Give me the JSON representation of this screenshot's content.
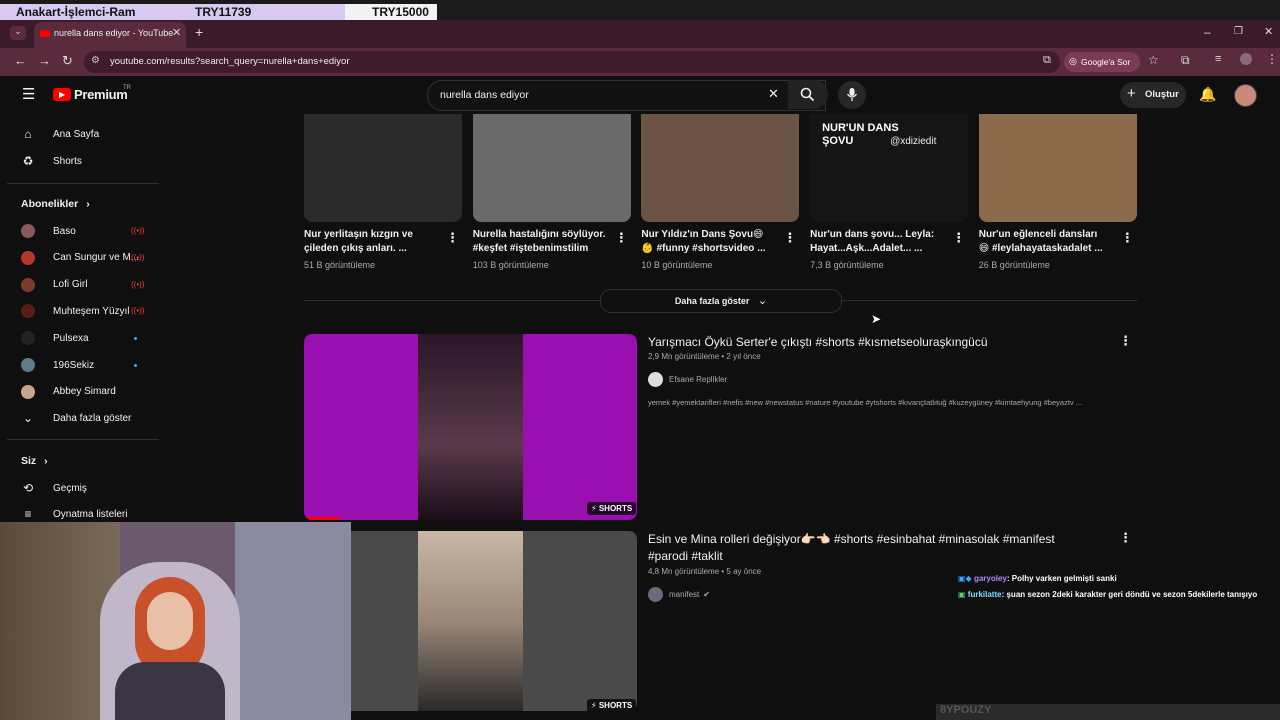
{
  "overlay": {
    "left_label": "Anakart-İşlemci-Ram",
    "mid_price": "TRY11739",
    "right_price": "TRY15000"
  },
  "browser": {
    "tab_title": "nurella dans ediyor - YouTube",
    "url": "youtube.com/results?search_query=nurella+dans+ediyor",
    "google_sor": "Google'a Sor"
  },
  "header": {
    "logo": "Premium",
    "logo_suffix": "TR",
    "search_value": "nurella dans ediyor",
    "create_label": "Oluştur"
  },
  "sidebar": {
    "home": "Ana Sayfa",
    "shorts": "Shorts",
    "subscriptions_title": "Abonelikler",
    "subscriptions": [
      {
        "name": "Baso",
        "status": "live",
        "color": "#8a5a5a"
      },
      {
        "name": "Can Sungur ve M...",
        "status": "live",
        "color": "#b4372e"
      },
      {
        "name": "Lofi Girl",
        "status": "live",
        "color": "#7a3b2a"
      },
      {
        "name": "Muhteşem Yüzyıl",
        "status": "live",
        "color": "#5a1d14"
      },
      {
        "name": "Pulsexa",
        "status": "new",
        "color": "#222222"
      },
      {
        "name": "196Sekiz",
        "status": "new",
        "color": "#5b7c8a"
      },
      {
        "name": "Abbey Simard",
        "status": "",
        "color": "#c9a58a"
      }
    ],
    "show_more": "Daha fazla göster",
    "you_title": "Siz",
    "history": "Geçmiş",
    "playlists": "Oynatma listeleri"
  },
  "shorts": [
    {
      "title_line1": "Nur yerlitaşın kızgın ve",
      "title_line2": "çileden çıkış anları. ...",
      "views": "51 B görüntüleme",
      "color": "#2a2a2a"
    },
    {
      "title_line1": "Nurella hastalığını söylüyor.",
      "title_line2": "#keşfet #iştebenimstilim",
      "views": "103 B görüntüleme",
      "color": "#6a6a6a"
    },
    {
      "title_line1": "Nur Yıldız'ın Dans Şovu😄",
      "title_line2": "👶 #funny #shortsvideo ...",
      "views": "10 B görüntüleme",
      "color": "#6b5346"
    },
    {
      "title_line1": "Nur'un dans şovu... Leyla:",
      "title_line2": "Hayat...Aşk...Adalet... ...",
      "views": "7,3 B görüntüleme",
      "color": "#151515",
      "overlay_text": "NUR'UN DANS ŞOVU",
      "overlay_handle": "@xdiziedit"
    },
    {
      "title_line1": "Nur'un eğlenceli dansları",
      "title_line2": "😄 #leylahayataskadalet ...",
      "views": "26 B görüntüleme",
      "color": "#8a6a4a"
    }
  ],
  "show_more_button": "Daha fazla göster",
  "videos": [
    {
      "title": "Yarışmacı Öykü Serter'e çıkıştı #shorts #kısmetseoluraşkıngücü",
      "meta": "2,9 Mn görüntüleme • 2 yıl önce",
      "channel": "Efsane Replikler",
      "description": "yemek #yemektarifleri #nefis #new #newstatus #nature #youtube #ytshorts #kıvançtatlıtuğ #kuzeygüney #kimtaehyung #beyaztv ...",
      "badge": "SHORTS"
    },
    {
      "title_line1": "Esin ve Mina rolleri değişiyor👉🏻👈🏻 #shorts #esinbahat #minasolak #manifest",
      "title_line2": "#parodi #taklit",
      "meta": "4,8 Mn görüntüleme • 5 ay önce",
      "channel": "manifest",
      "badge": "SHORTS"
    }
  ],
  "chat": [
    {
      "user": "garyoley",
      "message": ": Polhy varken gelmişti sanki"
    },
    {
      "user": "furkilatte",
      "message": ": şuan sezon 2deki karakter geri döndü ve sezon 5dekilerle tanışıyo"
    }
  ],
  "bottom_partial": "8YPOUZY"
}
